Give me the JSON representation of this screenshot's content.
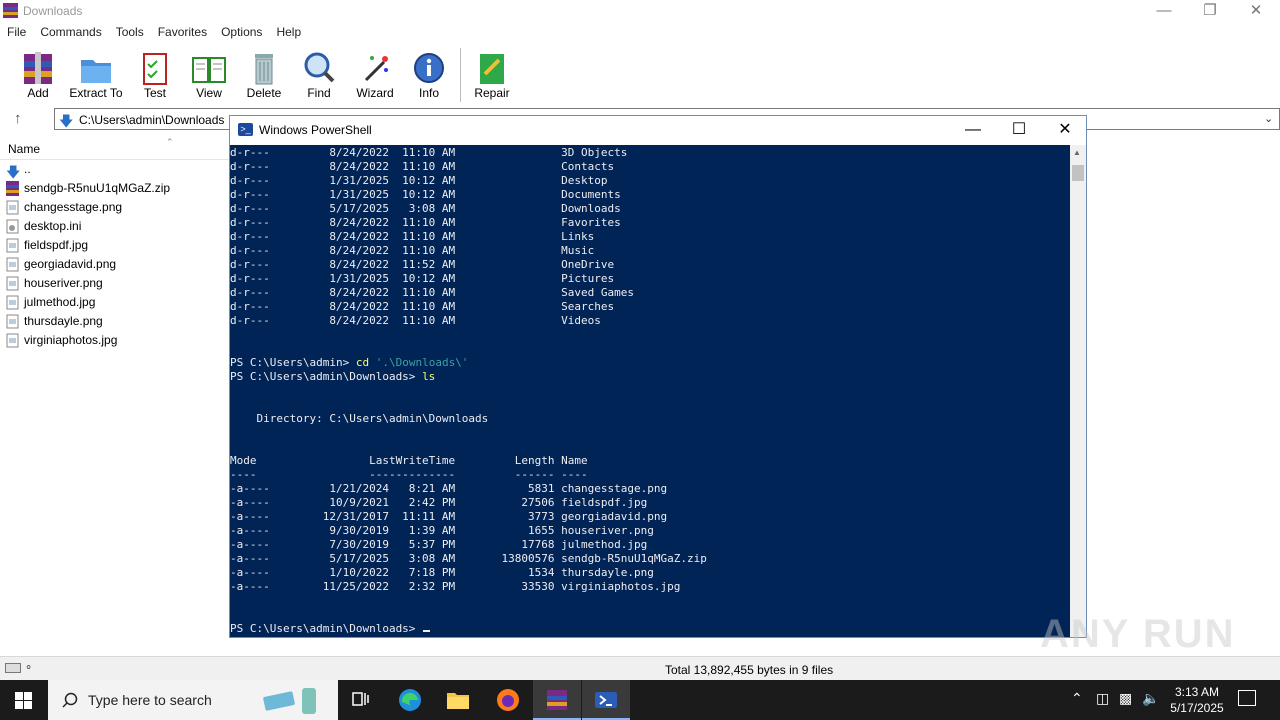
{
  "rar": {
    "title": "Downloads",
    "menu": [
      "File",
      "Commands",
      "Tools",
      "Favorites",
      "Options",
      "Help"
    ],
    "toolbar": [
      "Add",
      "Extract To",
      "Test",
      "View",
      "Delete",
      "Find",
      "Wizard",
      "Info",
      "Repair"
    ],
    "address": "C:\\Users\\admin\\Downloads",
    "column_name": "Name",
    "files": [
      "..",
      "sendgb-R5nuU1qMGaZ.zip",
      "changesstage.png",
      "desktop.ini",
      "fieldspdf.jpg",
      "georgiadavid.png",
      "houseriver.png",
      "julmethod.jpg",
      "thursdayle.png",
      "virginiaphotos.jpg"
    ],
    "status": "Total 13,892,455 bytes in 9 files"
  },
  "ps": {
    "title": "Windows PowerShell",
    "lines": [
      "d-r---         8/24/2022  11:10 AM                3D Objects",
      "d-r---         8/24/2022  11:10 AM                Contacts",
      "d-r---         1/31/2025  10:12 AM                Desktop",
      "d-r---         1/31/2025  10:12 AM                Documents",
      "d-r---         5/17/2025   3:08 AM                Downloads",
      "d-r---         8/24/2022  11:10 AM                Favorites",
      "d-r---         8/24/2022  11:10 AM                Links",
      "d-r---         8/24/2022  11:10 AM                Music",
      "d-r---         8/24/2022  11:52 AM                OneDrive",
      "d-r---         1/31/2025  10:12 AM                Pictures",
      "d-r---         8/24/2022  11:10 AM                Saved Games",
      "d-r---         8/24/2022  11:10 AM                Searches",
      "d-r---         8/24/2022  11:10 AM                Videos",
      "",
      "",
      "",
      "",
      "",
      "    Directory: C:\\Users\\admin\\Downloads",
      "",
      "",
      "Mode                 LastWriteTime         Length Name",
      "----                 -------------         ------ ----",
      "-a----         1/21/2024   8:21 AM           5831 changesstage.png",
      "-a----         10/9/2021   2:42 PM          27506 fieldspdf.jpg",
      "-a----        12/31/2017  11:11 AM           3773 georgiadavid.png",
      "-a----         9/30/2019   1:39 AM           1655 houseriver.png",
      "-a----         7/30/2019   5:37 PM          17768 julmethod.jpg",
      "-a----         5/17/2025   3:08 AM       13800576 sendgb-R5nuU1qMGaZ.zip",
      "-a----         1/10/2022   7:18 PM           1534 thursdayle.png",
      "-a----        11/25/2022   2:32 PM          33530 virginiaphotos.jpg"
    ],
    "prompt1": "PS C:\\Users\\admin> ",
    "cmd1": "cd",
    "arg1": " '.\\Downloads\\'",
    "prompt2": "PS C:\\Users\\admin\\Downloads> ",
    "cmd2": "ls",
    "prompt3": "PS C:\\Users\\admin\\Downloads> "
  },
  "taskbar": {
    "search_placeholder": "Type here to search",
    "time": "3:13 AM",
    "date": "5/17/2025"
  },
  "watermark": "ANY RUN"
}
